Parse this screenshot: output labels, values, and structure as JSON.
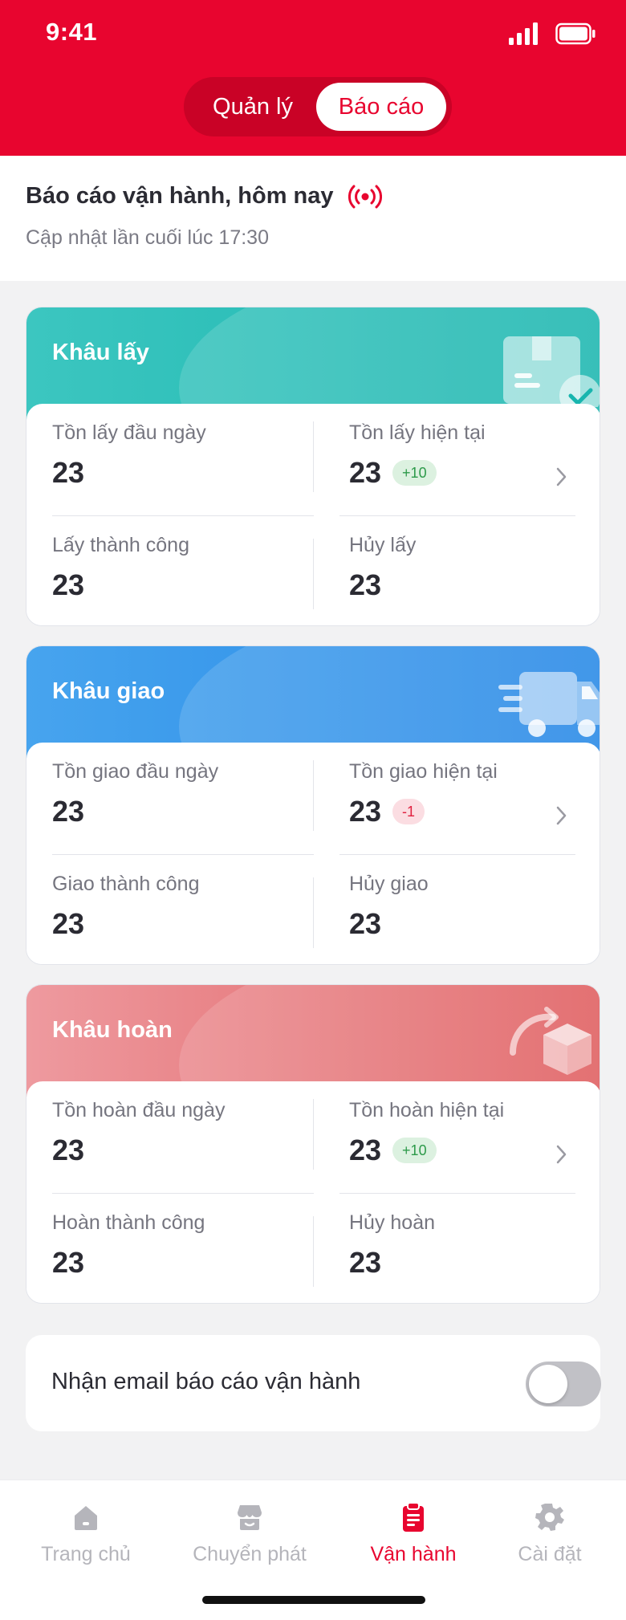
{
  "status_bar": {
    "time": "9:41"
  },
  "segment": {
    "items": [
      "Quản lý",
      "Báo cáo"
    ],
    "active_index": 1
  },
  "report": {
    "title": "Báo cáo vận hành, hôm nay",
    "updated": "Cập nhật lần cuối lúc 17:30"
  },
  "cards": [
    {
      "title": "Khâu lấy",
      "color": "#18b5ae",
      "icon": "package-check-icon",
      "cells": [
        {
          "label": "Tồn lấy đầu ngày",
          "value": "23"
        },
        {
          "label": "Tồn lấy hiện tại",
          "value": "23",
          "badge": "+10"
        },
        {
          "label": "Lấy thành công",
          "value": "23"
        },
        {
          "label": "Hủy lấy",
          "value": "23"
        }
      ]
    },
    {
      "title": "Khâu giao",
      "color": "#2386e6",
      "icon": "delivery-truck-icon",
      "cells": [
        {
          "label": "Tồn giao đầu ngày",
          "value": "23"
        },
        {
          "label": "Tồn giao hiện tại",
          "value": "23",
          "badge": "-1"
        },
        {
          "label": "Giao thành công",
          "value": "23"
        },
        {
          "label": "Hủy giao",
          "value": "23"
        }
      ]
    },
    {
      "title": "Khâu hoàn",
      "color": "#df5a5c",
      "icon": "return-box-icon",
      "cells": [
        {
          "label": "Tồn hoàn đầu ngày",
          "value": "23"
        },
        {
          "label": "Tồn hoàn hiện tại",
          "value": "23",
          "badge": "+10"
        },
        {
          "label": "Hoàn thành công",
          "value": "23"
        },
        {
          "label": "Hủy hoàn",
          "value": "23"
        }
      ]
    }
  ],
  "email_setting": {
    "label": "Nhận email báo cáo vận hành",
    "enabled": false
  },
  "tabs": [
    {
      "label": "Trang chủ",
      "icon": "home-icon"
    },
    {
      "label": "Chuyển phát",
      "icon": "shop-icon"
    },
    {
      "label": "Vận hành",
      "icon": "clipboard-icon",
      "active": true
    },
    {
      "label": "Cài đặt",
      "icon": "gear-icon"
    }
  ],
  "colors": {
    "brand": "#e8052f",
    "badge_up": "#2d9a4a",
    "badge_down": "#e0203f"
  }
}
